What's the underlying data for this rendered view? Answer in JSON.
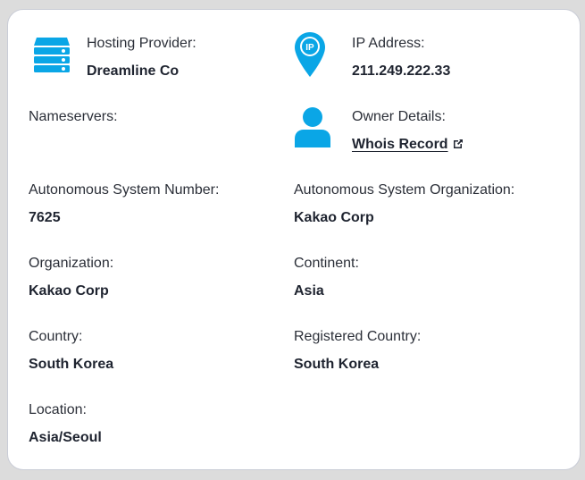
{
  "colors": {
    "accent": "#0aa6e6",
    "text": "#1f2430"
  },
  "hosting": {
    "label": "Hosting Provider:",
    "value": "Dreamline Co",
    "icon": "server-icon"
  },
  "ip": {
    "label": "IP Address:",
    "value": "211.249.222.33",
    "icon": "ip-pin-icon",
    "badge": "IP"
  },
  "nameservers": {
    "label": "Nameservers:"
  },
  "owner": {
    "label": "Owner Details:",
    "link": "Whois Record",
    "icon": "user-icon"
  },
  "asn": {
    "label": "Autonomous System Number:",
    "value": "7625"
  },
  "aso": {
    "label": "Autonomous System Organization:",
    "value": "Kakao Corp"
  },
  "organization": {
    "label": "Organization:",
    "value": "Kakao Corp"
  },
  "continent": {
    "label": "Continent:",
    "value": "Asia"
  },
  "country": {
    "label": "Country:",
    "value": "South Korea"
  },
  "registered_country": {
    "label": "Registered Country:",
    "value": "South Korea"
  },
  "location": {
    "label": "Location:",
    "value": "Asia/Seoul"
  }
}
